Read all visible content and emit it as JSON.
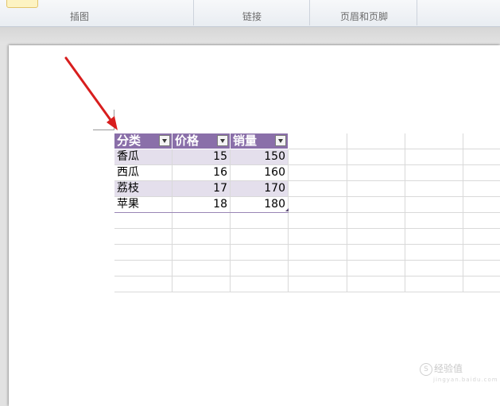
{
  "ribbon": {
    "groups": [
      "插图",
      "链接",
      "页眉和页脚"
    ]
  },
  "table": {
    "headers": [
      "分类",
      "价格",
      "销量"
    ],
    "rows": [
      [
        "香瓜",
        "15",
        "150"
      ],
      [
        "西瓜",
        "16",
        "160"
      ],
      [
        "荔枝",
        "17",
        "170"
      ],
      [
        "苹果",
        "18",
        "180"
      ]
    ],
    "header_color": "#8a6fa9",
    "band_color": "#e4dfec"
  },
  "annotation": {
    "arrow_color": "#d81e1e"
  },
  "watermark": {
    "text": "经验值",
    "icon": "S",
    "subtext": "jingyan.baidu.com"
  }
}
